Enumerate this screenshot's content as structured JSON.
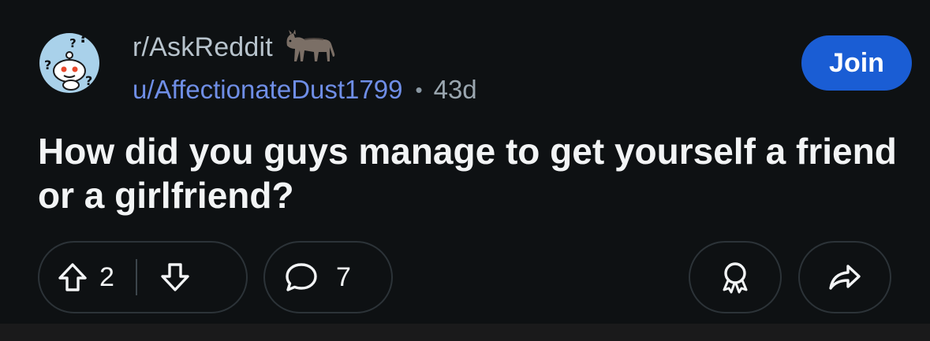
{
  "post": {
    "subreddit": "r/AskReddit",
    "username": "u/AffectionateDust1799",
    "separator": "•",
    "age": "43d",
    "join_label": "Join",
    "title": "How did you guys manage to get yourself a friend or a girlfriend?",
    "score": "2",
    "comments": "7"
  },
  "colors": {
    "background": "#0e1113",
    "join_button": "#1a5dd4",
    "username": "#6f8ee6",
    "subreddit": "#b7c3cc"
  },
  "icons": {
    "avatar": "snoo-question-avatar",
    "flair": "donkey-flair",
    "upvote": "arrow-up-icon",
    "downvote": "arrow-down-icon",
    "comment": "speech-bubble-icon",
    "award": "award-icon",
    "share": "share-arrow-icon"
  }
}
